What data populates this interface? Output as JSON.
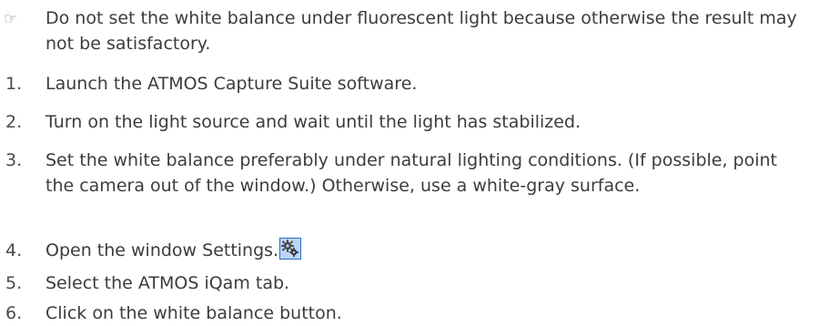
{
  "hint": {
    "marker": "☞",
    "text": "Do not set the white balance under fluorescent light because otherwise the result may not be satisfactory."
  },
  "steps": [
    {
      "number": "1.",
      "text": "Launch the ATMOS Capture Suite software."
    },
    {
      "number": "2.",
      "text": "Turn on the light source and wait until the light has stabilized."
    },
    {
      "number": "3.",
      "text": "Set the white balance preferably under natural lighting conditions. (If possible, point the camera out of the window.) Otherwise, use a white-gray surface."
    },
    {
      "number": "4.",
      "text": "Open the window Settings.",
      "icon": "settings-gears-icon"
    },
    {
      "number": "5.",
      "text": "Select the ATMOS iQam tab."
    },
    {
      "number": "6.",
      "text": "Click on the white balance button."
    }
  ]
}
